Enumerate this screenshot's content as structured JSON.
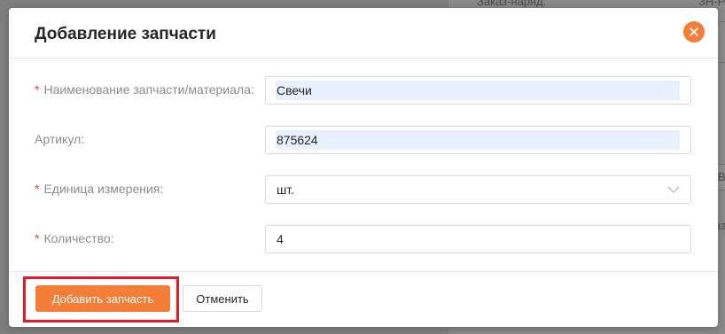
{
  "background": {
    "label_top": "Заказ-наряд:",
    "value_top": "ЗН-Р",
    "edge_a": "В",
    "edge_b": "аз"
  },
  "dialog": {
    "title": "Добавление запчасти",
    "fields": [
      {
        "label": "Наименование запчасти/материала:",
        "required": true,
        "value": "Свечи",
        "type": "text"
      },
      {
        "label": "Артикул:",
        "required": false,
        "value": "875624",
        "type": "text"
      },
      {
        "label": "Единица измерения:",
        "required": true,
        "value": "шт.",
        "type": "select"
      },
      {
        "label": "Количество:",
        "required": true,
        "value": "4",
        "type": "number"
      }
    ],
    "required_mark": "*",
    "submit_label": "Добавить запчасть",
    "cancel_label": "Отменить"
  },
  "colors": {
    "accent": "#f47d38",
    "required": "#e0463a",
    "highlight": "#e31b23",
    "autofill": "#e8f0fe"
  },
  "icons": {
    "close": "close-icon",
    "select": "chevron-down-icon"
  }
}
